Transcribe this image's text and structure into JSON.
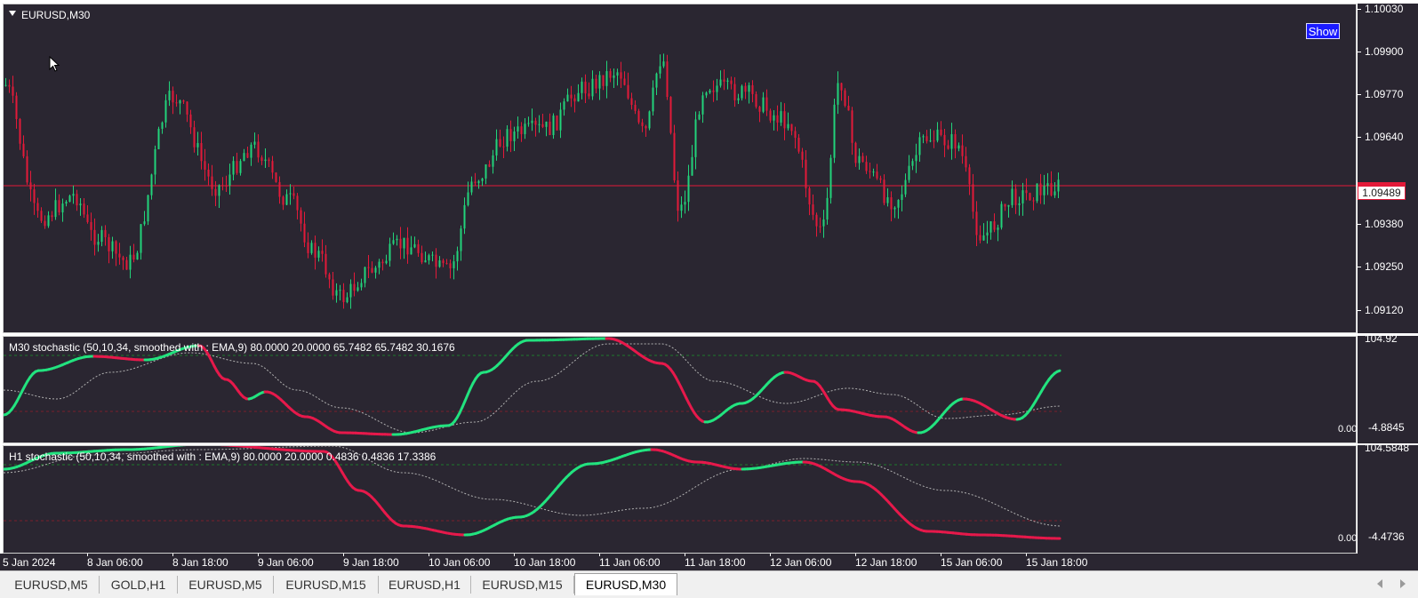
{
  "window": {
    "symbol_title": "EURUSD,M30"
  },
  "toolbar": {
    "show_label": "Show"
  },
  "main_chart": {
    "price_axis_labels": [
      "1.10030",
      "1.09900",
      "1.09770",
      "1.09640",
      "1.09380",
      "1.09250",
      "1.09120"
    ],
    "current_price": "1.09489",
    "colors": {
      "bull": "#22d37a",
      "bear": "#e31a39",
      "background": "#2a2631",
      "price_line": "#e31a39"
    }
  },
  "m30_indicator": {
    "title": "M30 stochastic (50,10,34, smoothed with : EMA,9) 80.0000 20.0000 65.7482 65.7482 30.1676",
    "axis_top": "104.92",
    "axis_bottom_a": "-4.8845",
    "axis_bottom_b": "0.00",
    "levels": [
      "80.0000",
      "20.0000"
    ],
    "colors": {
      "up": "#22e37f",
      "down": "#e6194b",
      "signal": "#b0b0b0",
      "level_high": "#1f7a2a",
      "level_low": "#7a1f2a"
    }
  },
  "h1_indicator": {
    "title": "H1 stochastic (50,10,34, smoothed with : EMA,9) 80.0000 20.0000 0.4836 0.4836 17.3386",
    "axis_top": "104.5848",
    "axis_bottom_a": "-4.4736",
    "axis_bottom_b": "0.00",
    "levels": [
      "80.0000",
      "20.0000"
    ]
  },
  "time_axis": {
    "labels": [
      "5 Jan 2024",
      "8 Jan 06:00",
      "8 Jan 18:00",
      "9 Jan 06:00",
      "9 Jan 18:00",
      "10 Jan 06:00",
      "10 Jan 18:00",
      "11 Jan 06:00",
      "11 Jan 18:00",
      "12 Jan 06:00",
      "12 Jan 18:00",
      "15 Jan 06:00",
      "15 Jan 18:00"
    ]
  },
  "tabs": [
    {
      "label": "EURUSD,M5",
      "active": false
    },
    {
      "label": "GOLD,H1",
      "active": false
    },
    {
      "label": "EURUSD,M5",
      "active": false
    },
    {
      "label": "EURUSD,M15",
      "active": false
    },
    {
      "label": "EURUSD,H1",
      "active": false
    },
    {
      "label": "EURUSD,M15",
      "active": false
    },
    {
      "label": "EURUSD,M30",
      "active": true
    }
  ]
}
